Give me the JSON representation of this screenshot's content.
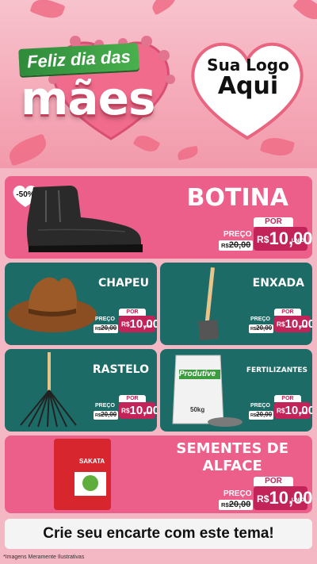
{
  "header": {
    "title_line1": "Feliz dia das",
    "title_line2": "mães",
    "logo_line1": "Sua Logo",
    "logo_line2": "Aqui"
  },
  "products": [
    {
      "name": "BOTINA",
      "discount": "-50%",
      "por": "POR",
      "preco": "PREÇO",
      "old_currency": "R$",
      "old_price": "20,00",
      "currency": "R$",
      "new_price": "10,00",
      "unit": "UNID"
    },
    {
      "name": "CHAPEU",
      "por": "POR",
      "preco": "PREÇO",
      "old_currency": "R$",
      "old_price": "20,00",
      "currency": "R$",
      "new_price": "10,00",
      "unit": "UNID"
    },
    {
      "name": "ENXADA",
      "por": "POR",
      "preco": "PREÇO",
      "old_currency": "R$",
      "old_price": "20,00",
      "currency": "R$",
      "new_price": "10,00",
      "unit": "UNID"
    },
    {
      "name": "RASTELO",
      "por": "POR",
      "preco": "PREÇO",
      "old_currency": "R$",
      "old_price": "20,00",
      "currency": "R$",
      "new_price": "10,00",
      "unit": "UNID"
    },
    {
      "name": "FERTILIZANTES",
      "bag_brand": "Produtive",
      "bag_weight": "50kg",
      "por": "POR",
      "preco": "PREÇO",
      "old_currency": "R$",
      "old_price": "20,00",
      "currency": "R$",
      "new_price": "10,00",
      "unit": "UNID"
    },
    {
      "name_line1": "SEMENTES DE",
      "name_line2": "ALFACE",
      "packet_brand": "SAKATA",
      "por": "POR",
      "preco": "PREÇO",
      "old_currency": "R$",
      "old_price": "20,00",
      "currency": "R$",
      "new_price": "10,00",
      "unit": "UNID"
    }
  ],
  "cta": "Crie seu encarte com este tema!",
  "disclaimer": "*Imagens Meramente Ilustrativas",
  "colors": {
    "pink": "#eb5f8a",
    "teal": "#1d6b67",
    "accent": "#c2245a",
    "green": "#49b04d"
  }
}
